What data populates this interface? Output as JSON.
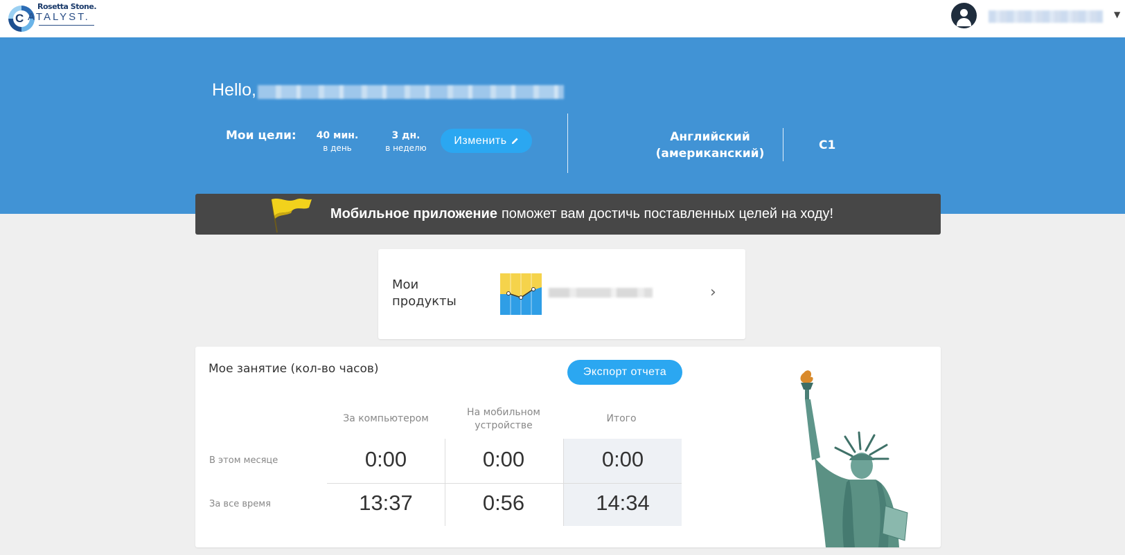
{
  "header": {
    "logo_brand": "Rosetta Stone.",
    "logo_product": "ATALYST.",
    "logo_product_initial": "C"
  },
  "hero": {
    "greeting": "Hello,",
    "goals_label": "Мои цели:",
    "goal_minutes_value": "40 мин.",
    "goal_minutes_unit": "в день",
    "goal_days_value": "3 дн.",
    "goal_days_unit": "в неделю",
    "edit_label": "Изменить",
    "language_line1": "Английский",
    "language_line2": "(американский)",
    "level": "C1"
  },
  "banner": {
    "bold_text": "Мобильное приложение",
    "text": "поможет вам достичь поставленных целей на ходу!"
  },
  "products": {
    "title_line1": "Мои",
    "title_line2": "продукты",
    "chevron": "›"
  },
  "activity": {
    "title": "Мое занятие (кол-во часов)",
    "export_label": "Экспорт отчета",
    "columns": {
      "computer": "За компьютером",
      "mobile_line1": "На мобильном",
      "mobile_line2": "устройстве",
      "total": "Итого"
    },
    "rows": [
      {
        "label": "В этом месяце",
        "computer": "0:00",
        "mobile": "0:00",
        "total": "0:00"
      },
      {
        "label": "За все время",
        "computer": "13:37",
        "mobile": "0:56",
        "total": "14:34"
      }
    ]
  },
  "colors": {
    "hero_bg": "#4193d5",
    "accent_button": "#2ba7f1",
    "banner_bg": "#474747",
    "page_bg": "#efefef"
  }
}
